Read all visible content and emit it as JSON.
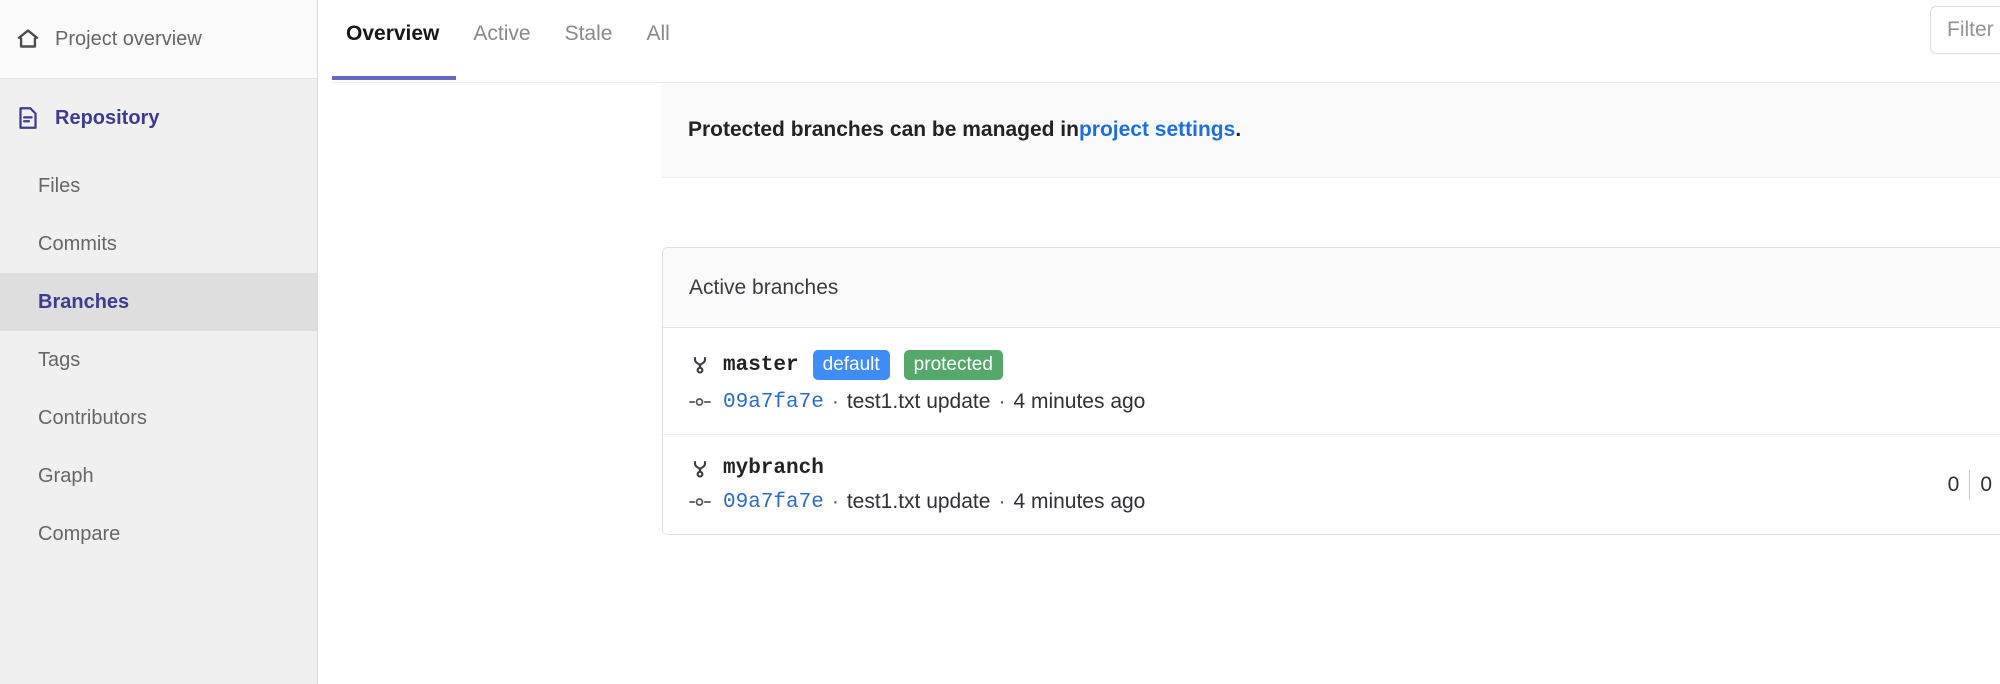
{
  "sidebar": {
    "top_item": {
      "label": "Project overview",
      "icon": "home-icon"
    },
    "section": {
      "label": "Repository",
      "icon": "document-icon"
    },
    "items": [
      {
        "label": "Files"
      },
      {
        "label": "Commits"
      },
      {
        "label": "Branches"
      },
      {
        "label": "Tags"
      },
      {
        "label": "Contributors"
      },
      {
        "label": "Graph"
      },
      {
        "label": "Compare"
      }
    ],
    "active_item": "Branches"
  },
  "tabs": [
    {
      "label": "Overview",
      "active": true
    },
    {
      "label": "Active",
      "active": false
    },
    {
      "label": "Stale",
      "active": false
    },
    {
      "label": "All",
      "active": false
    }
  ],
  "filter": {
    "placeholder": "Filter by branch name",
    "value": ""
  },
  "notice": {
    "text_before": "Protected branches can be managed in ",
    "link_label": "project settings",
    "text_after": "."
  },
  "card": {
    "header": "Active branches",
    "branches": [
      {
        "name": "master",
        "badges": [
          {
            "label": "default",
            "kind": "default"
          },
          {
            "label": "protected",
            "kind": "protected"
          }
        ],
        "commit": {
          "sha": "09a7fa7e",
          "message": "test1.txt update",
          "time": "4 minutes ago",
          "separator": "·"
        },
        "divergence": null
      },
      {
        "name": "mybranch",
        "badges": [],
        "commit": {
          "sha": "09a7fa7e",
          "message": "test1.txt update",
          "time": "4 minutes ago",
          "separator": "·"
        },
        "divergence": {
          "behind": "0",
          "ahead": "0"
        }
      }
    ]
  },
  "colors": {
    "accent_indigo": "#3c3c91",
    "tab_underline": "#6666c4",
    "link_blue": "#1f6fdb",
    "sha_blue": "#2b6cc4",
    "badge_default": "#3f8ef7",
    "badge_protected": "#55a86a",
    "sidebar_bg": "#f0f0f0"
  }
}
